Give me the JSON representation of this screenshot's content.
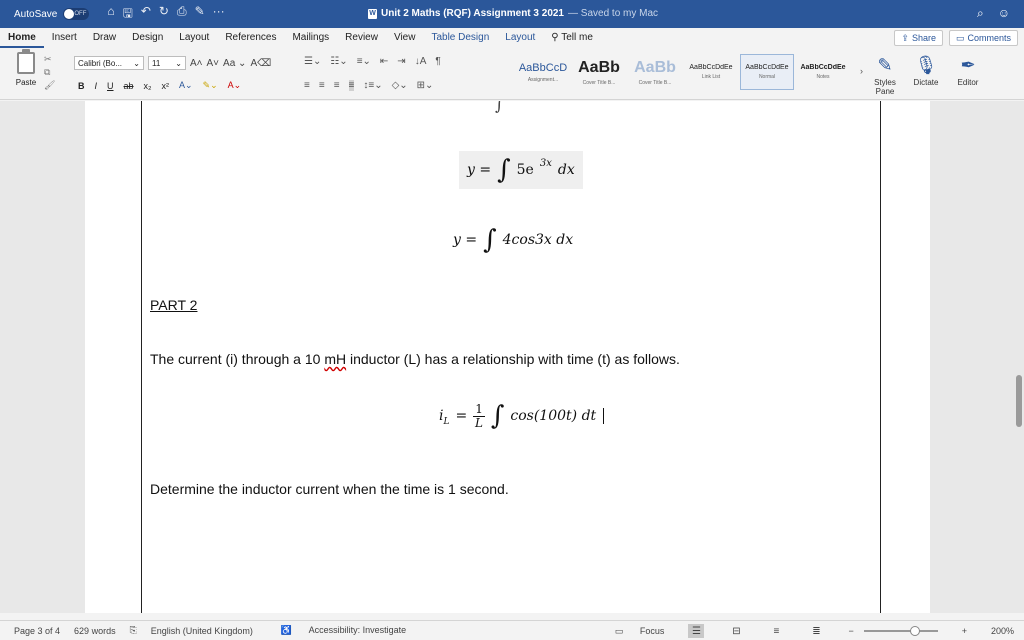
{
  "titlebar": {
    "autosave_label": "AutoSave",
    "autosave_state": "OFF",
    "doc_title": "Unit 2 Maths (RQF) Assignment 3 2021",
    "saved_status": "— Saved to my Mac",
    "quick_access": [
      "⌂",
      "🖫",
      "↶",
      "↻",
      "⎙",
      "✎",
      "···"
    ],
    "right_icons": [
      "⌕",
      "☺"
    ]
  },
  "tabs": [
    "Home",
    "Insert",
    "Draw",
    "Design",
    "Layout",
    "References",
    "Mailings",
    "Review",
    "View",
    "Table Design",
    "Layout",
    "Tell me"
  ],
  "tab_buttons": {
    "share": "Share",
    "comments": "Comments"
  },
  "ribbon": {
    "paste_label": "Paste",
    "font_name": "Calibri (Bo...",
    "font_size": "11",
    "case_label": "Aa",
    "format_buttons": [
      "B",
      "I",
      "U",
      "ab",
      "x₂",
      "x²"
    ],
    "styles": [
      {
        "sample": "AaBbCcD",
        "name": "Assignment..."
      },
      {
        "sample": "AaBb",
        "name": "Cover Title B..."
      },
      {
        "sample": "AaBb",
        "name": "Cover Title B..."
      },
      {
        "sample": "AaBbCcDdEe",
        "name": "Link List"
      },
      {
        "sample": "AaBbCcDdEe",
        "name": "Normal"
      },
      {
        "sample": "AaBbCcDdEe",
        "name": "Notes"
      }
    ],
    "styles_pane": "Styles Pane",
    "dictate": "Dictate",
    "editor": "Editor"
  },
  "document": {
    "eq1": {
      "y": "y =",
      "base": "5e",
      "exp": "3x",
      "dx": "dx"
    },
    "eq2": {
      "y": "y =",
      "body": "4cos3x dx"
    },
    "part_heading": "PART 2",
    "para_pre": "The current (i) through a 10 ",
    "para_unit": "mH",
    "para_post": " inductor (L) has a relationship with time (t) as follows.",
    "eq3": {
      "lhs": "i",
      "lhs_sub": "L",
      "eq": "=",
      "num": "1",
      "den": "L",
      "body": "cos(100t) dt"
    },
    "question": "Determine the inductor current when the time is 1 second."
  },
  "status": {
    "page": "Page 3 of 4",
    "words": "629 words",
    "language": "English (United Kingdom)",
    "accessibility": "Accessibility: Investigate",
    "focus": "Focus",
    "zoom": "200%"
  }
}
